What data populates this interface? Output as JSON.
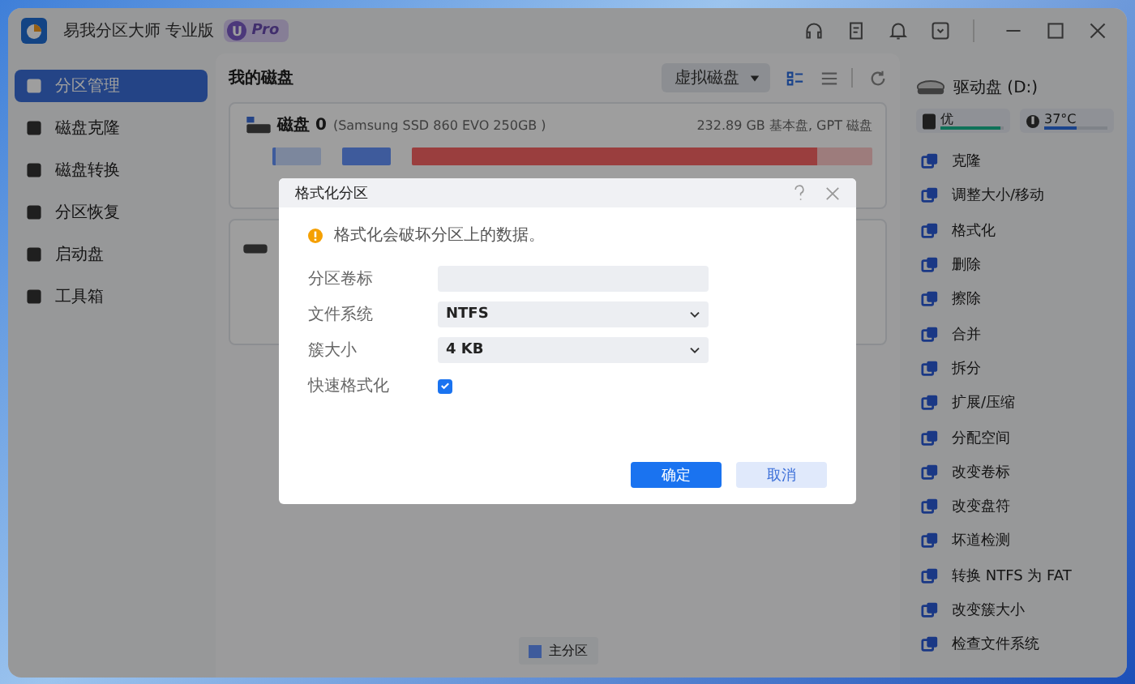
{
  "window": {
    "title": "易我分区大师 专业版",
    "badge_mark": "U",
    "badge": "Pro"
  },
  "sidebar": {
    "items": [
      {
        "label": "分区管理",
        "selected": true
      },
      {
        "label": "磁盘克隆",
        "selected": false
      },
      {
        "label": "磁盘转换",
        "selected": false
      },
      {
        "label": "分区恢复",
        "selected": false
      },
      {
        "label": "启动盘",
        "selected": false
      },
      {
        "label": "工具箱",
        "selected": false
      }
    ]
  },
  "main": {
    "heading": "我的磁盘",
    "view_dropdown": "虚拟磁盘",
    "view_modes": [
      {
        "kind": "grid",
        "selected": true
      },
      {
        "kind": "list",
        "selected": false
      }
    ],
    "disks": [
      {
        "name": "磁盘 0",
        "model": "(Samsung SSD 860 EVO 250GB )",
        "info": "232.89 GB 基本盘, GPT 磁盘",
        "partitions": [
          {
            "color": "#3e5c9c",
            "level": 0.08
          },
          {
            "color": "#3e5c9c",
            "level": 1
          },
          {
            "color": "#9a3e3e",
            "level": 0.88
          }
        ]
      }
    ],
    "legend": [
      {
        "label": "主分区",
        "color": "#3e5c9c"
      }
    ]
  },
  "right_panel": {
    "drive": "驱动盘 (D:)",
    "health": {
      "label": "优",
      "level": 0.95
    },
    "temperature": {
      "label": "37°C",
      "level": 0.52
    },
    "actions": [
      "克隆",
      "调整大小/移动",
      "格式化",
      "删除",
      "擦除",
      "合并",
      "拆分",
      "扩展/压缩",
      "分配空间",
      "改变卷标",
      "改变盘符",
      "坏道检测",
      "转换 NTFS 为 FAT",
      "改变簇大小",
      "检查文件系统"
    ]
  },
  "dialog": {
    "title": "格式化分区",
    "warning": "格式化会破坏分区上的数据。",
    "fields": [
      {
        "kind": "text",
        "label": "分区卷标"
      },
      {
        "kind": "select",
        "label": "文件系统",
        "value": "NTFS"
      },
      {
        "kind": "select",
        "label": "簇大小",
        "value": "4 KB"
      },
      {
        "kind": "checkbox",
        "label": "快速格式化",
        "checked": true
      }
    ],
    "buttons": [
      {
        "label": "确定",
        "primary": true
      },
      {
        "label": "取消",
        "primary": false
      }
    ]
  }
}
